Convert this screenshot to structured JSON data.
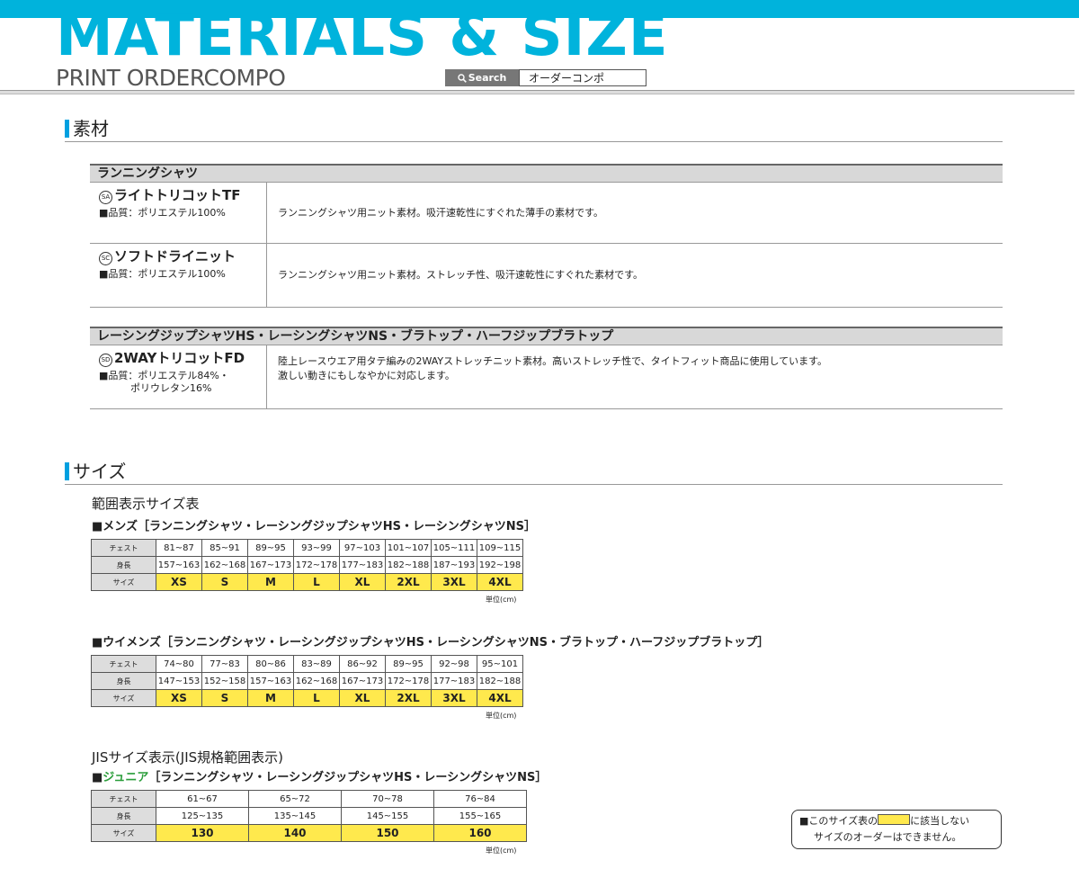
{
  "header": {
    "title": "MATERIALS & SIZE",
    "subtitle": "PRINT ORDERCOMPO",
    "search_label": "Search",
    "search_value": "オーダーコンポ"
  },
  "materials": {
    "heading": "素材",
    "groups": [
      {
        "title": "ランニングシャツ",
        "items": [
          {
            "code": "SA",
            "name": "ライトトリコットTF",
            "quality": "■品質：ポリエステル100%",
            "quality2": "",
            "desc": "ランニングシャツ用ニット素材。吸汗速乾性にすぐれた薄手の素材です。",
            "desc2": ""
          },
          {
            "code": "SC",
            "name": "ソフトドライニット",
            "quality": "■品質：ポリエステル100%",
            "quality2": "",
            "desc": "ランニングシャツ用ニット素材。ストレッチ性、吸汗速乾性にすぐれた素材です。",
            "desc2": ""
          }
        ]
      },
      {
        "title": "レーシングジップシャツHS・レーシングシャツNS・ブラトップ・ハーフジップブラトップ",
        "items": [
          {
            "code": "SD",
            "name": "2WAYトリコットFD",
            "quality": "■品質：ポリエステル84%・",
            "quality2": "ポリウレタン16%",
            "desc": "陸上レースウエア用タテ編みの2WAYストレッチニット素材。高いストレッチ性で、タイトフィット商品に使用しています。",
            "desc2": "激しい動きにもしなやかに対応します。"
          }
        ]
      }
    ]
  },
  "size": {
    "heading": "サイズ",
    "range_heading": "範囲表示サイズ表",
    "jis_heading": "JISサイズ表示(JIS規格範囲表示)",
    "row_labels": {
      "chest": "チェスト",
      "height": "身長",
      "size": "サイズ"
    },
    "unit": "単位(cm)",
    "mens": {
      "title": "■メンズ［ランニングシャツ・レーシングジップシャツHS・レーシングシャツNS］",
      "chest": [
        "81~87",
        "85~91",
        "89~95",
        "93~99",
        "97~103",
        "101~107",
        "105~111",
        "109~115"
      ],
      "height": [
        "157~163",
        "162~168",
        "167~173",
        "172~178",
        "177~183",
        "182~188",
        "187~193",
        "192~198"
      ],
      "sizes": [
        "XS",
        "S",
        "M",
        "L",
        "XL",
        "2XL",
        "3XL",
        "4XL"
      ]
    },
    "womens": {
      "title": "■ウイメンズ［ランニングシャツ・レーシングジップシャツHS・レーシングシャツNS・ブラトップ・ハーフジップブラトップ］",
      "chest": [
        "74~80",
        "77~83",
        "80~86",
        "83~89",
        "86~92",
        "89~95",
        "92~98",
        "95~101"
      ],
      "height": [
        "147~153",
        "152~158",
        "157~163",
        "162~168",
        "167~173",
        "172~178",
        "177~183",
        "182~188"
      ],
      "sizes": [
        "XS",
        "S",
        "M",
        "L",
        "XL",
        "2XL",
        "3XL",
        "4XL"
      ]
    },
    "junior": {
      "title_prefix": "■",
      "title_green": "ジュニア",
      "title_rest": "［ランニングシャツ・レーシングジップシャツHS・レーシングシャツNS］",
      "chest": [
        "61~67",
        "65~72",
        "70~78",
        "76~84"
      ],
      "height": [
        "125~135",
        "135~145",
        "145~155",
        "155~165"
      ],
      "sizes": [
        "130",
        "140",
        "150",
        "160"
      ]
    },
    "note": {
      "line1_a": "■このサイズ表の",
      "line1_b": "に該当しない",
      "line2": "サイズのオーダーはできません。"
    }
  },
  "colors": {
    "accent": "#00b3dc",
    "highlight": "#ffe94d",
    "junior_green": "#2a9d3a"
  }
}
